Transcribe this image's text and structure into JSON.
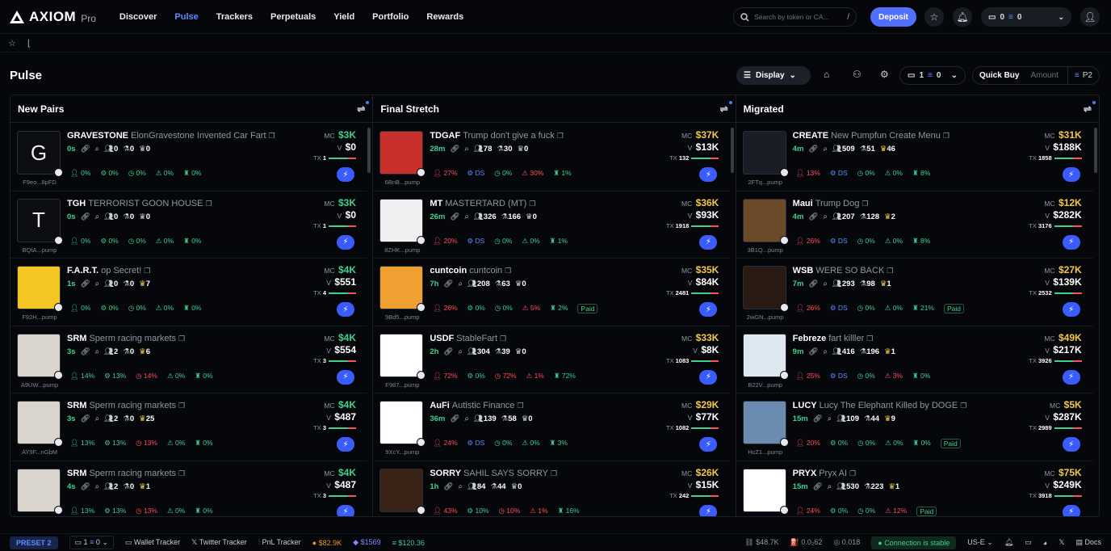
{
  "header": {
    "brand": "AXIOM",
    "brand_suffix": "Pro",
    "nav": [
      "Discover",
      "Pulse",
      "Trackers",
      "Perpetuals",
      "Yield",
      "Portfolio",
      "Rewards"
    ],
    "active_nav": "Pulse",
    "search_placeholder": "Search by token or CA...",
    "search_key": "/",
    "deposit_label": "Deposit",
    "wallet_count": "0",
    "balance": "0"
  },
  "page": {
    "title": "Pulse",
    "display_label": "Display",
    "selector_a": "1",
    "selector_b": "0",
    "quick_buy_label": "Quick Buy",
    "amount_placeholder": "Amount",
    "preset": "P2"
  },
  "columns": [
    {
      "title": "New Pairs",
      "cards": [
        {
          "thumb": "G",
          "symbol": "GRAVESTONE",
          "name": "ElonGravestone Invented Car Fart",
          "addr": "F9eo...8pFD",
          "age": "0s",
          "holders": "0",
          "pro": "0",
          "snipers": "0",
          "mc": "$3K",
          "vol": "$0",
          "tx": "1",
          "stats": [
            "0%",
            "0%",
            "0%",
            "0%",
            "0%"
          ]
        },
        {
          "thumb": "T",
          "symbol": "TGH",
          "name": "TERRORIST GOON HOUSE",
          "addr": "BQtA...pump",
          "age": "0s",
          "holders": "0",
          "pro": "0",
          "snipers": "0",
          "mc": "$3K",
          "vol": "$0",
          "tx": "1",
          "stats": [
            "0%",
            "0%",
            "0%",
            "0%",
            "0%"
          ]
        },
        {
          "thumb": "",
          "symbol": "F.A.R.T.",
          "name": "op Secret!",
          "addr": "F92H...pump",
          "age": "1s",
          "holders": "0",
          "pro": "0",
          "snipers": "7",
          "mc": "$4K",
          "vol": "$551",
          "tx": "4",
          "stats": [
            "0%",
            "0%",
            "0%",
            "0%",
            "0%"
          ]
        },
        {
          "thumb": "",
          "symbol": "SRM",
          "name": "Sperm racing markets",
          "addr": "A9UW...pump",
          "age": "3s",
          "holders": "2",
          "pro": "0",
          "snipers": "6",
          "mc": "$4K",
          "vol": "$554",
          "tx": "3",
          "stats": [
            "14%",
            "13%",
            "14%",
            "0%",
            "0%"
          ]
        },
        {
          "thumb": "",
          "symbol": "SRM",
          "name": "Sperm racing markets",
          "addr": "AY9F...nGbM",
          "age": "3s",
          "holders": "2",
          "pro": "0",
          "snipers": "25",
          "mc": "$4K",
          "vol": "$487",
          "tx": "3",
          "stats": [
            "13%",
            "13%",
            "13%",
            "0%",
            "0%"
          ]
        },
        {
          "thumb": "",
          "symbol": "SRM",
          "name": "Sperm racing markets",
          "addr": "",
          "age": "4s",
          "holders": "2",
          "pro": "0",
          "snipers": "1",
          "mc": "$4K",
          "vol": "$487",
          "tx": "3",
          "stats": [
            "13%",
            "13%",
            "13%",
            "0%",
            "0%"
          ]
        }
      ]
    },
    {
      "title": "Final Stretch",
      "cards": [
        {
          "thumb": "",
          "symbol": "TDGAF",
          "name": "Trump don't give a fuck",
          "addr": "6BnB...pump",
          "age": "28m",
          "holders": "78",
          "pro": "30",
          "snipers": "0",
          "mc": "$37K",
          "vol": "$13K",
          "tx": "132",
          "stats": [
            "27%",
            "DS",
            "0%",
            "30%",
            "1%"
          ]
        },
        {
          "thumb": "",
          "symbol": "MT",
          "name": "MASTERTARD (MT)",
          "addr": "8ZHK...pump",
          "age": "26m",
          "holders": "326",
          "pro": "166",
          "snipers": "0",
          "mc": "$36K",
          "vol": "$93K",
          "tx": "1918",
          "stats": [
            "20%",
            "DS",
            "0%",
            "0%",
            "1%"
          ]
        },
        {
          "thumb": "",
          "symbol": "cuntcoin",
          "name": "cuntcoin",
          "addr": "9Bd5...pump",
          "age": "7h",
          "holders": "208",
          "pro": "63",
          "snipers": "0",
          "mc": "$35K",
          "vol": "$84K",
          "tx": "2481",
          "stats": [
            "26%",
            "0%",
            "0%",
            "5%",
            "2%"
          ],
          "paid": "Paid"
        },
        {
          "thumb": "",
          "symbol": "USDF",
          "name": "StableFart",
          "addr": "F987...pump",
          "age": "2h",
          "holders": "304",
          "pro": "39",
          "snipers": "0",
          "mc": "$33K",
          "vol": "$8K",
          "tx": "1083",
          "stats": [
            "72%",
            "0%",
            "72%",
            "1%",
            "72%"
          ]
        },
        {
          "thumb": "",
          "symbol": "AuFi",
          "name": "Autistic Finance",
          "addr": "9XcY...pump",
          "age": "36m",
          "holders": "139",
          "pro": "58",
          "snipers": "0",
          "mc": "$29K",
          "vol": "$77K",
          "tx": "1082",
          "stats": [
            "24%",
            "DS",
            "0%",
            "0%",
            "3%"
          ]
        },
        {
          "thumb": "",
          "symbol": "SORRY",
          "name": "SAHIL SAYS SORRY",
          "addr": "",
          "age": "1h",
          "holders": "84",
          "pro": "44",
          "snipers": "0",
          "mc": "$26K",
          "vol": "$15K",
          "tx": "242",
          "stats": [
            "43%",
            "10%",
            "10%",
            "1%",
            "16%"
          ]
        }
      ]
    },
    {
      "title": "Migrated",
      "cards": [
        {
          "thumb": "",
          "symbol": "CREATE",
          "name": "New Pumpfun Create Menu",
          "addr": "2FTq...pump",
          "age": "4m",
          "holders": "509",
          "pro": "51",
          "snipers": "46",
          "mc": "$31K",
          "vol": "$188K",
          "tx": "1858",
          "stats": [
            "13%",
            "DS",
            "0%",
            "0%",
            "8%"
          ]
        },
        {
          "thumb": "",
          "symbol": "Maui",
          "name": "Trump Dog",
          "addr": "3B1Q...pump",
          "age": "4m",
          "holders": "207",
          "pro": "128",
          "snipers": "2",
          "mc": "$12K",
          "vol": "$282K",
          "tx": "3176",
          "stats": [
            "26%",
            "DS",
            "0%",
            "0%",
            "8%"
          ]
        },
        {
          "thumb": "",
          "symbol": "WSB",
          "name": "WERE SO BACK",
          "addr": "2wGN...pump",
          "age": "7m",
          "holders": "293",
          "pro": "98",
          "snipers": "1",
          "mc": "$27K",
          "vol": "$139K",
          "tx": "2532",
          "stats": [
            "26%",
            "DS",
            "0%",
            "0%",
            "21%"
          ],
          "paid": "Paid"
        },
        {
          "thumb": "",
          "symbol": "Febreze",
          "name": "fart killler",
          "addr": "B22V...pump",
          "age": "9m",
          "holders": "416",
          "pro": "196",
          "snipers": "1",
          "mc": "$49K",
          "vol": "$217K",
          "tx": "3926",
          "stats": [
            "25%",
            "DS",
            "0%",
            "3%",
            "0%"
          ]
        },
        {
          "thumb": "",
          "symbol": "LUCY",
          "name": "Lucy The Elephant Killed by DOGE",
          "addr": "HcZ1...pump",
          "age": "15m",
          "holders": "109",
          "pro": "44",
          "snipers": "9",
          "mc": "$5K",
          "vol": "$287K",
          "tx": "2989",
          "stats": [
            "20%",
            "0%",
            "0%",
            "0%",
            "0%"
          ],
          "paid": "Paid"
        },
        {
          "thumb": "",
          "symbol": "PRYX",
          "name": "Pryx AI",
          "addr": "",
          "age": "15m",
          "holders": "530",
          "pro": "223",
          "snipers": "1",
          "mc": "$75K",
          "vol": "$249K",
          "tx": "3918",
          "stats": [
            "24%",
            "0%",
            "0%",
            "12%",
            ""
          ],
          "paid": "Paid"
        }
      ]
    }
  ],
  "footer": {
    "preset": "PRESET 2",
    "sel_a": "1",
    "sel_b": "0",
    "wallet_tracker": "Wallet Tracker",
    "twitter_tracker": "Twitter Tracker",
    "pnl_tracker": "PnL Tracker",
    "btc": "$82.9K",
    "eth": "$1569",
    "sol": "$120.36",
    "mcap": "$48.7K",
    "gas": "0.0₂62",
    "fee": "0.018",
    "connection": "Connection is stable",
    "region": "US-E",
    "docs": "Docs"
  },
  "colors": {
    "accent": "#526fff",
    "green": "#3fcf8e",
    "red": "#ff4d5a",
    "yellow": "#f2c94c"
  }
}
